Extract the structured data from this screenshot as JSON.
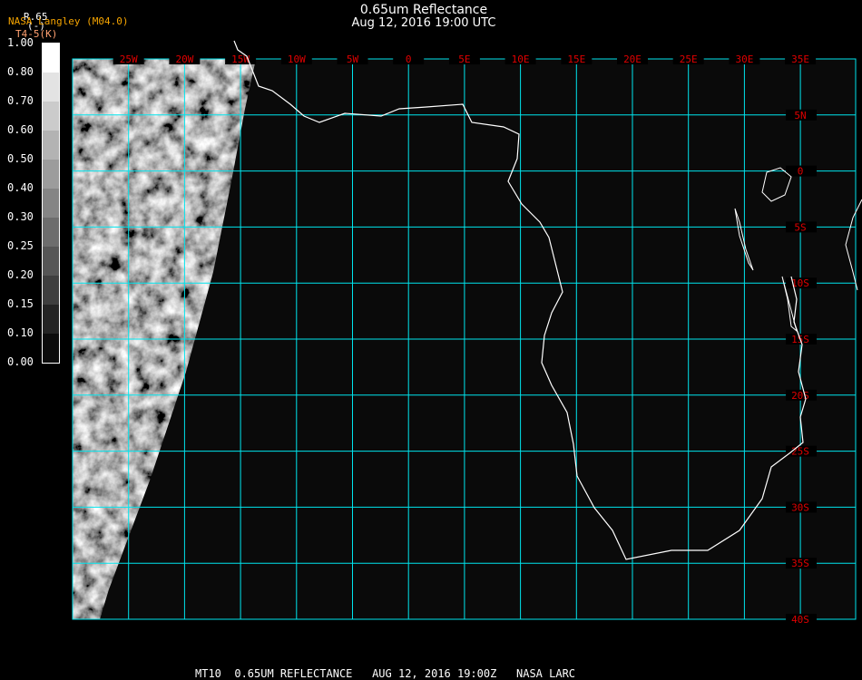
{
  "header": {
    "title": "0.65um Reflectance",
    "subtitle": "Aug 12, 2016 19:00 UTC"
  },
  "legend": {
    "variable": "R.65",
    "source": "NASA Langley (M04.0)",
    "unit": "(-)",
    "alt_label": "T4-5(K)",
    "ticks": [
      "1.00",
      "0.80",
      "0.70",
      "0.60",
      "0.50",
      "0.40",
      "0.30",
      "0.25",
      "0.20",
      "0.15",
      "0.10",
      "0.00"
    ],
    "colors": [
      "#ffffff",
      "#e3e3e3",
      "#cbcbcb",
      "#b3b3b3",
      "#9c9c9c",
      "#858585",
      "#6d6d6d",
      "#565656",
      "#3f3f3f",
      "#242424",
      "#0c0c0c"
    ]
  },
  "map": {
    "grid_color": "#00e5ee",
    "label_color": "#e00000",
    "background": "#0a0a0a",
    "lon_labels": [
      "25W",
      "20W",
      "15W",
      "10W",
      "5W",
      "0",
      "5E",
      "10E",
      "15E",
      "20E",
      "25E",
      "30E",
      "35E"
    ],
    "lat_labels": [
      "5N",
      "0",
      "5S",
      "10S",
      "15S",
      "20S",
      "25S",
      "30S",
      "35S",
      "40S"
    ]
  },
  "footer": "MT10  0.65UM REFLECTANCE   AUG 12, 2016 19:00Z   NASA LARC"
}
